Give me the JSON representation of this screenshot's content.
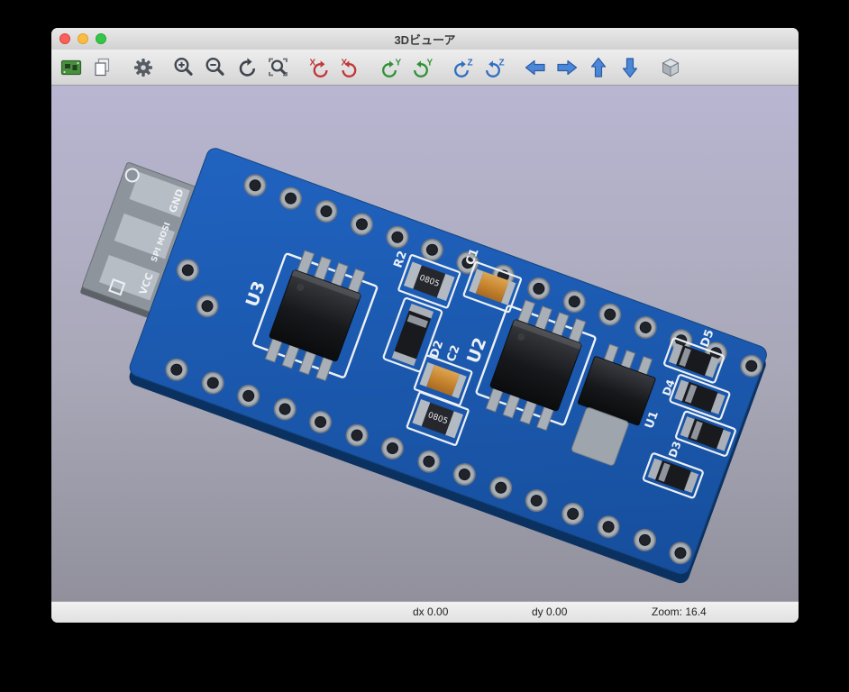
{
  "window": {
    "title": "3Dビューア",
    "traffic_lights": [
      "close",
      "minimize",
      "zoom"
    ]
  },
  "toolbar": {
    "buttons": [
      "reload-board",
      "copy-3d-image",
      "render-options",
      "zoom-in",
      "zoom-out",
      "redraw",
      "zoom-to-fit",
      "rotate-x-cw",
      "rotate-x-ccw",
      "rotate-y-cw",
      "rotate-y-ccw",
      "rotate-z-cw",
      "rotate-z-ccw",
      "move-left",
      "move-right",
      "move-up",
      "move-down",
      "orthographic-projection"
    ]
  },
  "viewport": {
    "background_top": "#b8b6d1",
    "background_bottom": "#91909c"
  },
  "board": {
    "soldermask_color": "#1a57ad",
    "silkscreen_color": "#edf1f5",
    "silkscreen": {
      "usb_gnd": "GND",
      "usb_spi": "SPI MOSI",
      "usb_vcc": "VCC",
      "u1": "U1",
      "u2": "U2",
      "u3": "U3",
      "r2": "R2",
      "c1": "C1",
      "c2": "C2",
      "d2": "D2",
      "d3": "D3",
      "d4": "D4",
      "d5": "D5",
      "marking_r2": "0805",
      "marking_r1": "0805"
    }
  },
  "statusbar": {
    "fields": [
      {
        "label": "dx",
        "value": "0.00"
      },
      {
        "label": "dy",
        "value": "0.00"
      },
      {
        "label": "Zoom:",
        "value": "16.4"
      }
    ]
  }
}
